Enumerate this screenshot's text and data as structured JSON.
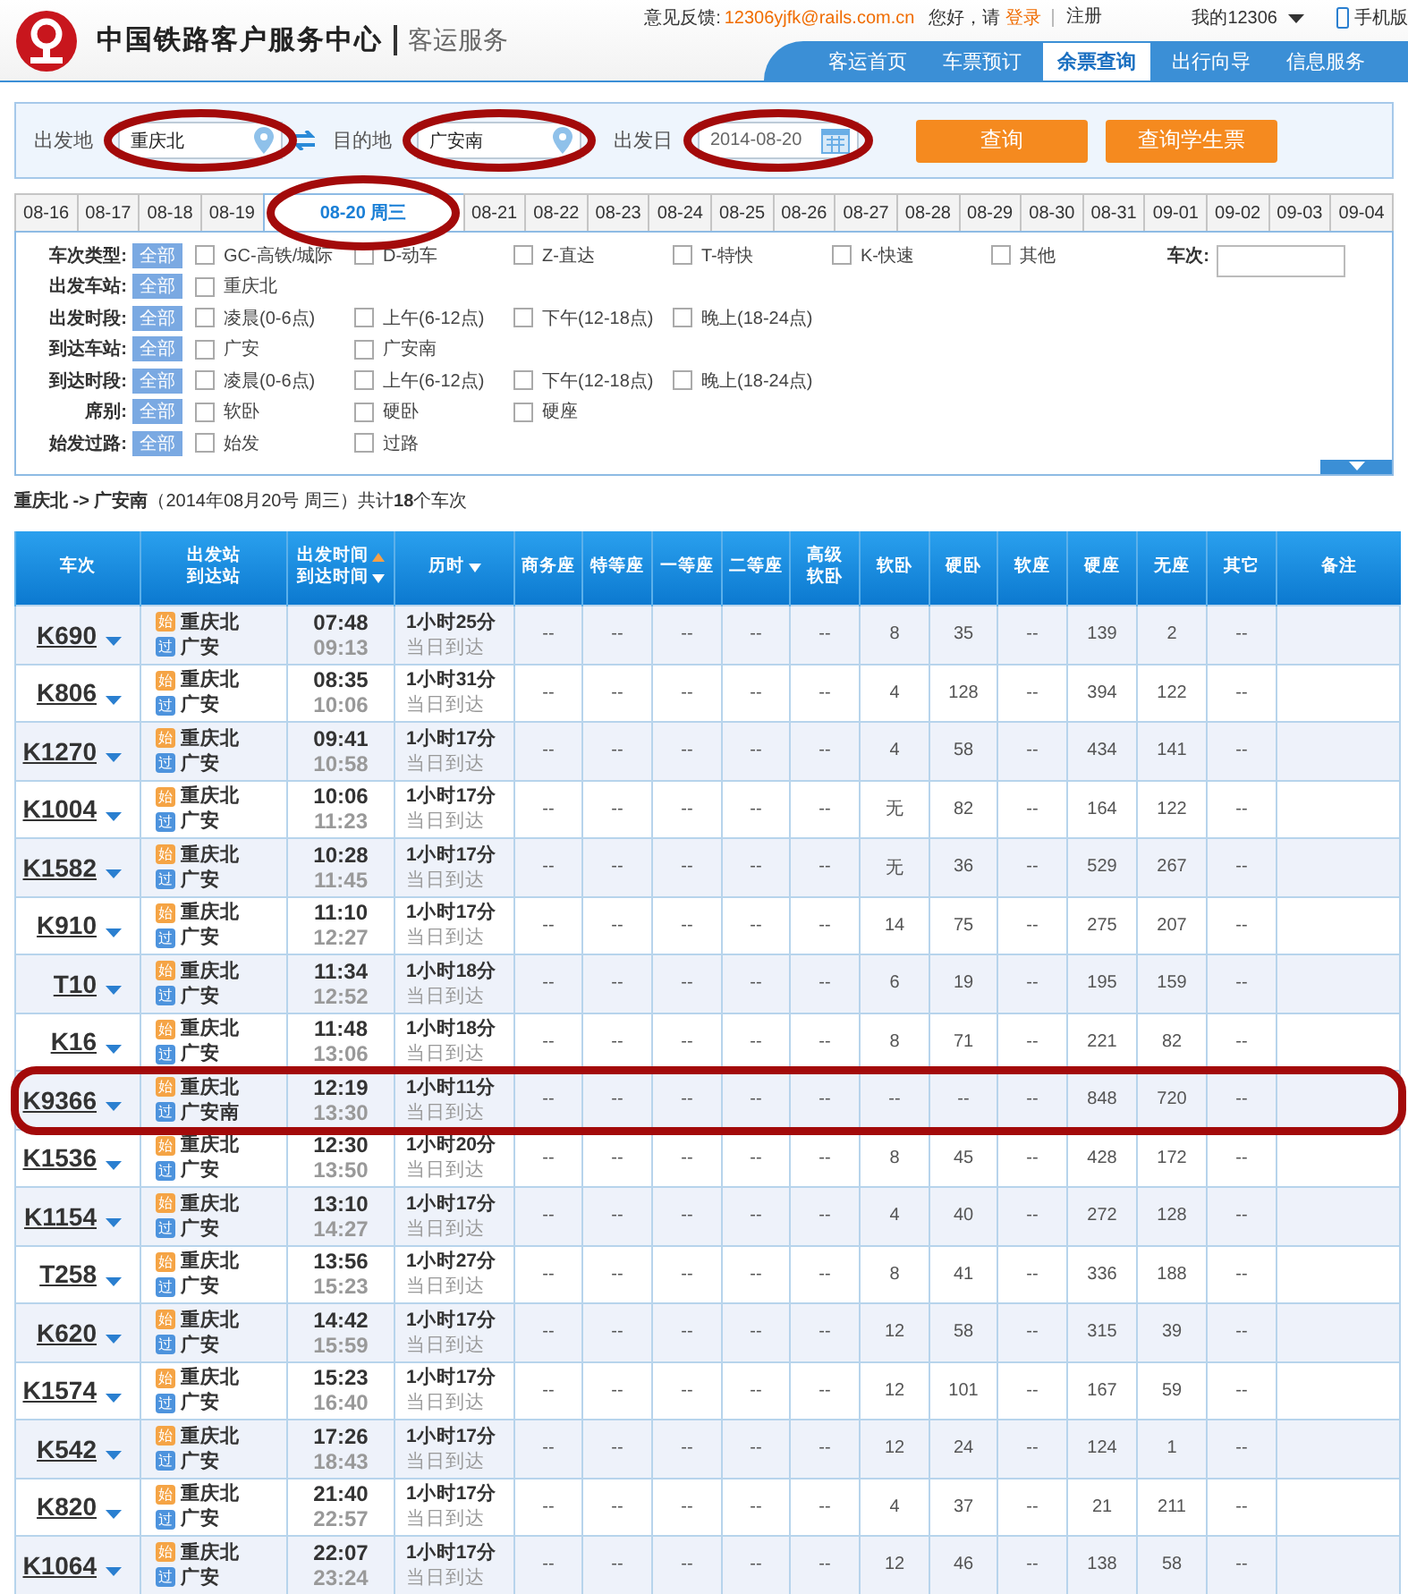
{
  "header": {
    "site_name": "中国铁路客户服务中心",
    "section": "客运服务",
    "feedback_label": "意见反馈:",
    "feedback_email": "12306yjfk@rails.com.cn",
    "greeting": "您好，请",
    "login": "登录",
    "register": "注册",
    "my_account": "我的12306",
    "mobile": "手机版"
  },
  "nav": [
    {
      "label": "客运首页",
      "selected": false
    },
    {
      "label": "车票预订",
      "selected": false
    },
    {
      "label": "余票查询",
      "selected": true
    },
    {
      "label": "出行向导",
      "selected": false
    },
    {
      "label": "信息服务",
      "selected": false
    }
  ],
  "search": {
    "fields": [
      {
        "label": "出发地",
        "value": "重庆北",
        "kind": "station",
        "circled": true
      },
      {
        "label": "目的地",
        "value": "广安南",
        "kind": "station",
        "circled": true
      },
      {
        "label": "出发日",
        "value": "2014-08-20",
        "kind": "date",
        "circled": true
      }
    ],
    "buttons": [
      "查询",
      "查询学生票"
    ]
  },
  "date_tabs": [
    {
      "label": "08-16",
      "selected": false,
      "circled": false
    },
    {
      "label": "08-17",
      "selected": false,
      "circled": false
    },
    {
      "label": "08-18",
      "selected": false,
      "circled": false
    },
    {
      "label": "08-19",
      "selected": false,
      "circled": false
    },
    {
      "label": "08-20 周三",
      "selected": true,
      "circled": true
    },
    {
      "label": "08-21",
      "selected": false,
      "circled": false
    },
    {
      "label": "08-22",
      "selected": false,
      "circled": false
    },
    {
      "label": "08-23",
      "selected": false,
      "circled": false
    },
    {
      "label": "08-24",
      "selected": false,
      "circled": false
    },
    {
      "label": "08-25",
      "selected": false,
      "circled": false
    },
    {
      "label": "08-26",
      "selected": false,
      "circled": false
    },
    {
      "label": "08-27",
      "selected": false,
      "circled": false
    },
    {
      "label": "08-28",
      "selected": false,
      "circled": false
    },
    {
      "label": "08-29",
      "selected": false,
      "circled": false
    },
    {
      "label": "08-30",
      "selected": false,
      "circled": false
    },
    {
      "label": "08-31",
      "selected": false,
      "circled": false
    },
    {
      "label": "09-01",
      "selected": false,
      "circled": false
    },
    {
      "label": "09-02",
      "selected": false,
      "circled": false
    },
    {
      "label": "09-03",
      "selected": false,
      "circled": false
    },
    {
      "label": "09-04",
      "selected": false,
      "circled": false
    }
  ],
  "filters": [
    {
      "label": "车次类型:",
      "all": "全部",
      "options": [
        {
          "label": "GC-高铁/城际",
          "checked": false
        },
        {
          "label": "D-动车",
          "checked": false
        },
        {
          "label": "Z-直达",
          "checked": false
        },
        {
          "label": "T-特快",
          "checked": false
        },
        {
          "label": "K-快速",
          "checked": false
        },
        {
          "label": "其他",
          "checked": false
        }
      ]
    },
    {
      "label": "出发车站:",
      "all": "全部",
      "options": [
        {
          "label": "重庆北",
          "checked": false
        }
      ]
    },
    {
      "label": "出发时段:",
      "all": "全部",
      "options": [
        {
          "label": "凌晨(0-6点)",
          "checked": false
        },
        {
          "label": "上午(6-12点)",
          "checked": false
        },
        {
          "label": "下午(12-18点)",
          "checked": false
        },
        {
          "label": "晚上(18-24点)",
          "checked": false
        }
      ]
    },
    {
      "label": "到达车站:",
      "all": "全部",
      "options": [
        {
          "label": "广安",
          "checked": false
        },
        {
          "label": "广安南",
          "checked": false
        }
      ]
    },
    {
      "label": "到达时段:",
      "all": "全部",
      "options": [
        {
          "label": "凌晨(0-6点)",
          "checked": false
        },
        {
          "label": "上午(6-12点)",
          "checked": false
        },
        {
          "label": "下午(12-18点)",
          "checked": false
        },
        {
          "label": "晚上(18-24点)",
          "checked": false
        }
      ]
    },
    {
      "label": "席别:",
      "all": "全部",
      "options": [
        {
          "label": "软卧",
          "checked": false
        },
        {
          "label": "硬卧",
          "checked": false
        },
        {
          "label": "硬座",
          "checked": false
        }
      ]
    },
    {
      "label": "始发过路:",
      "all": "全部",
      "options": [
        {
          "label": "始发",
          "checked": false
        },
        {
          "label": "过路",
          "checked": false
        }
      ]
    }
  ],
  "train_no_filter": {
    "label": "车次:"
  },
  "summary": "**重庆北 -> 广安南**（2014年08月20号 周三）共计**18**个车次",
  "table": {
    "columns": [
      {
        "lines": [
          {
            "text": "车次"
          }
        ]
      },
      {
        "lines": [
          {
            "text": "出发站"
          },
          {
            "text": "到达站"
          }
        ]
      },
      {
        "lines": [
          {
            "text": "出发时间",
            "kind": "sort_up"
          },
          {
            "text": "到达时间",
            "kind": "sort_down"
          }
        ]
      },
      {
        "lines": [
          {
            "text": "历时",
            "kind": "sort_down"
          }
        ]
      },
      {
        "lines": [
          {
            "text": "商务座"
          }
        ]
      },
      {
        "lines": [
          {
            "text": "特等座"
          }
        ]
      },
      {
        "lines": [
          {
            "text": "一等座"
          }
        ]
      },
      {
        "lines": [
          {
            "text": "二等座"
          }
        ]
      },
      {
        "lines": [
          {
            "text": "高级"
          },
          {
            "text": "软卧"
          }
        ]
      },
      {
        "lines": [
          {
            "text": "软卧"
          }
        ]
      },
      {
        "lines": [
          {
            "text": "硬卧"
          }
        ]
      },
      {
        "lines": [
          {
            "text": "软座"
          }
        ]
      },
      {
        "lines": [
          {
            "text": "硬座"
          }
        ]
      },
      {
        "lines": [
          {
            "text": "无座"
          }
        ]
      },
      {
        "lines": [
          {
            "text": "其它"
          }
        ]
      },
      {
        "lines": [
          {
            "text": "备注"
          }
        ]
      }
    ],
    "rows": [
      {
        "train": "K690",
        "from_tag": "始",
        "from": "重庆北",
        "to_tag": "过",
        "to": "广安",
        "depart": "07:48",
        "arrive": "09:13",
        "duration": "1小时25分",
        "arrival_day": "当日到达",
        "seats": [
          "--",
          "--",
          "--",
          "--",
          "--",
          "8",
          "35",
          "--",
          "139",
          "2",
          "--"
        ],
        "circled": false
      },
      {
        "train": "K806",
        "from_tag": "始",
        "from": "重庆北",
        "to_tag": "过",
        "to": "广安",
        "depart": "08:35",
        "arrive": "10:06",
        "duration": "1小时31分",
        "arrival_day": "当日到达",
        "seats": [
          "--",
          "--",
          "--",
          "--",
          "--",
          "4",
          "128",
          "--",
          "394",
          "122",
          "--"
        ],
        "circled": false
      },
      {
        "train": "K1270",
        "from_tag": "始",
        "from": "重庆北",
        "to_tag": "过",
        "to": "广安",
        "depart": "09:41",
        "arrive": "10:58",
        "duration": "1小时17分",
        "arrival_day": "当日到达",
        "seats": [
          "--",
          "--",
          "--",
          "--",
          "--",
          "4",
          "58",
          "--",
          "434",
          "141",
          "--"
        ],
        "circled": false
      },
      {
        "train": "K1004",
        "from_tag": "始",
        "from": "重庆北",
        "to_tag": "过",
        "to": "广安",
        "depart": "10:06",
        "arrive": "11:23",
        "duration": "1小时17分",
        "arrival_day": "当日到达",
        "seats": [
          "--",
          "--",
          "--",
          "--",
          "--",
          "无",
          "82",
          "--",
          "164",
          "122",
          "--"
        ],
        "circled": false
      },
      {
        "train": "K1582",
        "from_tag": "始",
        "from": "重庆北",
        "to_tag": "过",
        "to": "广安",
        "depart": "10:28",
        "arrive": "11:45",
        "duration": "1小时17分",
        "arrival_day": "当日到达",
        "seats": [
          "--",
          "--",
          "--",
          "--",
          "--",
          "无",
          "36",
          "--",
          "529",
          "267",
          "--"
        ],
        "circled": false
      },
      {
        "train": "K910",
        "from_tag": "始",
        "from": "重庆北",
        "to_tag": "过",
        "to": "广安",
        "depart": "11:10",
        "arrive": "12:27",
        "duration": "1小时17分",
        "arrival_day": "当日到达",
        "seats": [
          "--",
          "--",
          "--",
          "--",
          "--",
          "14",
          "75",
          "--",
          "275",
          "207",
          "--"
        ],
        "circled": false
      },
      {
        "train": "T10",
        "from_tag": "始",
        "from": "重庆北",
        "to_tag": "过",
        "to": "广安",
        "depart": "11:34",
        "arrive": "12:52",
        "duration": "1小时18分",
        "arrival_day": "当日到达",
        "seats": [
          "--",
          "--",
          "--",
          "--",
          "--",
          "6",
          "19",
          "--",
          "195",
          "159",
          "--"
        ],
        "circled": false
      },
      {
        "train": "K16",
        "from_tag": "始",
        "from": "重庆北",
        "to_tag": "过",
        "to": "广安",
        "depart": "11:48",
        "arrive": "13:06",
        "duration": "1小时18分",
        "arrival_day": "当日到达",
        "seats": [
          "--",
          "--",
          "--",
          "--",
          "--",
          "8",
          "71",
          "--",
          "221",
          "82",
          "--"
        ],
        "circled": false
      },
      {
        "train": "K9366",
        "from_tag": "始",
        "from": "重庆北",
        "to_tag": "过",
        "to": "广安南",
        "depart": "12:19",
        "arrive": "13:30",
        "duration": "1小时11分",
        "arrival_day": "当日到达",
        "seats": [
          "--",
          "--",
          "--",
          "--",
          "--",
          "--",
          "--",
          "--",
          "848",
          "720",
          "--"
        ],
        "circled": true
      },
      {
        "train": "K1536",
        "from_tag": "始",
        "from": "重庆北",
        "to_tag": "过",
        "to": "广安",
        "depart": "12:30",
        "arrive": "13:50",
        "duration": "1小时20分",
        "arrival_day": "当日到达",
        "seats": [
          "--",
          "--",
          "--",
          "--",
          "--",
          "8",
          "45",
          "--",
          "428",
          "172",
          "--"
        ],
        "circled": false
      },
      {
        "train": "K1154",
        "from_tag": "始",
        "from": "重庆北",
        "to_tag": "过",
        "to": "广安",
        "depart": "13:10",
        "arrive": "14:27",
        "duration": "1小时17分",
        "arrival_day": "当日到达",
        "seats": [
          "--",
          "--",
          "--",
          "--",
          "--",
          "4",
          "40",
          "--",
          "272",
          "128",
          "--"
        ],
        "circled": false
      },
      {
        "train": "T258",
        "from_tag": "始",
        "from": "重庆北",
        "to_tag": "过",
        "to": "广安",
        "depart": "13:56",
        "arrive": "15:23",
        "duration": "1小时27分",
        "arrival_day": "当日到达",
        "seats": [
          "--",
          "--",
          "--",
          "--",
          "--",
          "8",
          "41",
          "--",
          "336",
          "188",
          "--"
        ],
        "circled": false
      },
      {
        "train": "K620",
        "from_tag": "始",
        "from": "重庆北",
        "to_tag": "过",
        "to": "广安",
        "depart": "14:42",
        "arrive": "15:59",
        "duration": "1小时17分",
        "arrival_day": "当日到达",
        "seats": [
          "--",
          "--",
          "--",
          "--",
          "--",
          "12",
          "58",
          "--",
          "315",
          "39",
          "--"
        ],
        "circled": false
      },
      {
        "train": "K1574",
        "from_tag": "始",
        "from": "重庆北",
        "to_tag": "过",
        "to": "广安",
        "depart": "15:23",
        "arrive": "16:40",
        "duration": "1小时17分",
        "arrival_day": "当日到达",
        "seats": [
          "--",
          "--",
          "--",
          "--",
          "--",
          "12",
          "101",
          "--",
          "167",
          "59",
          "--"
        ],
        "circled": false
      },
      {
        "train": "K542",
        "from_tag": "始",
        "from": "重庆北",
        "to_tag": "过",
        "to": "广安",
        "depart": "17:26",
        "arrive": "18:43",
        "duration": "1小时17分",
        "arrival_day": "当日到达",
        "seats": [
          "--",
          "--",
          "--",
          "--",
          "--",
          "12",
          "24",
          "--",
          "124",
          "1",
          "--"
        ],
        "circled": false
      },
      {
        "train": "K820",
        "from_tag": "始",
        "from": "重庆北",
        "to_tag": "过",
        "to": "广安",
        "depart": "21:40",
        "arrive": "22:57",
        "duration": "1小时17分",
        "arrival_day": "当日到达",
        "seats": [
          "--",
          "--",
          "--",
          "--",
          "--",
          "4",
          "37",
          "--",
          "21",
          "211",
          "--"
        ],
        "circled": false
      },
      {
        "train": "K1064",
        "from_tag": "始",
        "from": "重庆北",
        "to_tag": "过",
        "to": "广安",
        "depart": "22:07",
        "arrive": "23:24",
        "duration": "1小时17分",
        "arrival_day": "当日到达",
        "seats": [
          "--",
          "--",
          "--",
          "--",
          "--",
          "12",
          "46",
          "--",
          "138",
          "58",
          "--"
        ],
        "circled": false
      }
    ]
  }
}
